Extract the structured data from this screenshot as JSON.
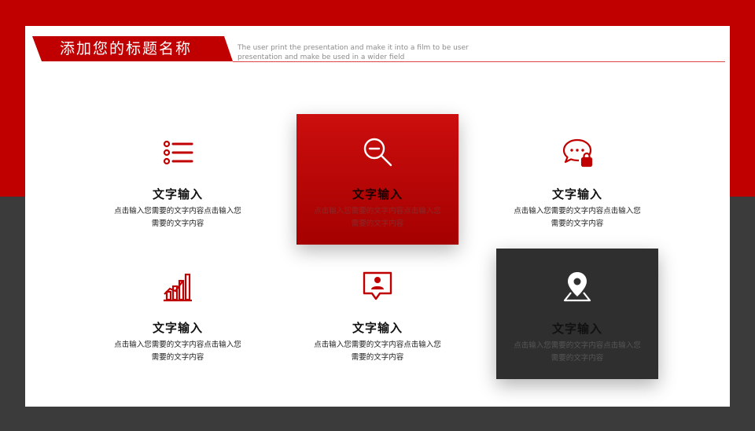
{
  "header": {
    "title": "添加您的标题名称",
    "subtitle": "The user print the presentation and make it into a film to be user presentation and make be used in a wider field"
  },
  "colors": {
    "accent": "#c00000",
    "dark": "#3b3b3b",
    "panel": "#ffffff"
  },
  "cards": [
    {
      "title": "文字输入",
      "desc": "点击输入您需要的文字内容点击输入您需要的文字内容",
      "icon": "list-icon",
      "style": "plain"
    },
    {
      "title": "文字输入",
      "desc": "点击输入您需要的文字内容点击输入您需要的文字内容",
      "icon": "zoom-out-icon",
      "style": "red"
    },
    {
      "title": "文字输入",
      "desc": "点击输入您需要的文字内容点击输入您需要的文字内容",
      "icon": "chat-lock-icon",
      "style": "plain"
    },
    {
      "title": "文字输入",
      "desc": "点击输入您需要的文字内容点击输入您需要的文字内容",
      "icon": "signal-chart-icon",
      "style": "plain"
    },
    {
      "title": "文字输入",
      "desc": "点击输入您需要的文字内容点击输入您需要的文字内容",
      "icon": "user-message-icon",
      "style": "plain"
    },
    {
      "title": "文字输入",
      "desc": "点击输入您需要的文字内容点击输入您需要的文字内容",
      "icon": "map-pin-icon",
      "style": "dark"
    }
  ]
}
